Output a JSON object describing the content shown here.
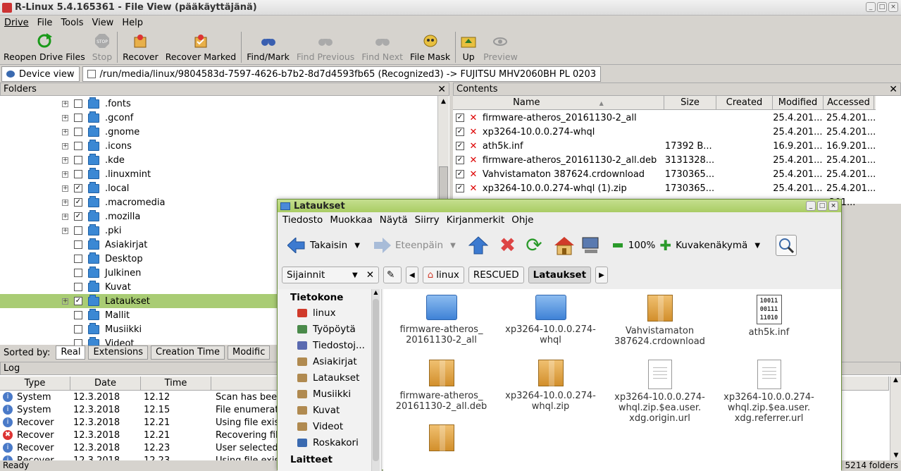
{
  "window": {
    "title": "R-Linux 5.4.165361 - File View (pääkäyttäjänä)"
  },
  "menu": [
    "Drive",
    "File",
    "Tools",
    "View",
    "Help"
  ],
  "toolbar": {
    "buttons": [
      {
        "label": "Reopen Drive Files",
        "icon": "reload-icon",
        "enabled": true
      },
      {
        "label": "Stop",
        "icon": "stop-icon",
        "enabled": false
      },
      {
        "label": "Recover",
        "icon": "recover-icon",
        "enabled": true
      },
      {
        "label": "Recover Marked",
        "icon": "recover-marked-icon",
        "enabled": true
      },
      {
        "label": "Find/Mark",
        "icon": "binoculars-icon",
        "enabled": true
      },
      {
        "label": "Find Previous",
        "icon": "binoculars-icon",
        "enabled": false
      },
      {
        "label": "Find Next",
        "icon": "binoculars-icon",
        "enabled": false
      },
      {
        "label": "File Mask",
        "icon": "mask-icon",
        "enabled": true
      },
      {
        "label": "Up",
        "icon": "up-folder-icon",
        "enabled": true
      },
      {
        "label": "Preview",
        "icon": "eye-icon",
        "enabled": false
      }
    ]
  },
  "tabs": {
    "device_view": "Device view",
    "path": "/run/media/linux/9804583d-7597-4626-b7b2-8d7d4593fb65 (Recognized3) -> FUJITSU MHV2060BH PL 0203"
  },
  "folders": {
    "header": "Folders",
    "items": [
      {
        "name": ".fonts",
        "checked": false,
        "expander": true
      },
      {
        "name": ".gconf",
        "checked": false,
        "expander": true
      },
      {
        "name": ".gnome",
        "checked": false,
        "expander": true
      },
      {
        "name": ".icons",
        "checked": false,
        "expander": true
      },
      {
        "name": ".kde",
        "checked": false,
        "expander": true
      },
      {
        "name": ".linuxmint",
        "checked": false,
        "expander": true
      },
      {
        "name": ".local",
        "checked": true,
        "expander": true
      },
      {
        "name": ".macromedia",
        "checked": true,
        "expander": true
      },
      {
        "name": ".mozilla",
        "checked": true,
        "expander": true
      },
      {
        "name": ".pki",
        "checked": false,
        "expander": true
      },
      {
        "name": "Asiakirjat",
        "checked": false,
        "expander": false
      },
      {
        "name": "Desktop",
        "checked": false,
        "expander": false
      },
      {
        "name": "Julkinen",
        "checked": false,
        "expander": false
      },
      {
        "name": "Kuvat",
        "checked": false,
        "expander": false
      },
      {
        "name": "Lataukset",
        "checked": true,
        "expander": true,
        "selected": true
      },
      {
        "name": "Mallit",
        "checked": false,
        "expander": false
      },
      {
        "name": "Musiikki",
        "checked": false,
        "expander": false
      },
      {
        "name": "Videot",
        "checked": false,
        "expander": false
      }
    ]
  },
  "contents": {
    "header": "Contents",
    "columns": [
      "Name",
      "Size",
      "Created",
      "Modified",
      "Accessed"
    ],
    "rows": [
      {
        "name": "firmware-atheros_20161130-2_all",
        "size": "",
        "created": "",
        "modified": "25.4.201...",
        "accessed": "25.4.201..."
      },
      {
        "name": "xp3264-10.0.0.274-whql",
        "size": "",
        "created": "",
        "modified": "25.4.201...",
        "accessed": "25.4.201..."
      },
      {
        "name": "ath5k.inf",
        "size": "17392 B...",
        "created": "",
        "modified": "16.9.201...",
        "accessed": "16.9.201..."
      },
      {
        "name": "firmware-atheros_20161130-2_all.deb",
        "size": "3131328...",
        "created": "",
        "modified": "25.4.201...",
        "accessed": "25.4.201..."
      },
      {
        "name": "Vahvistamaton 387624.crdownload",
        "size": "1730365...",
        "created": "",
        "modified": "25.4.201...",
        "accessed": "25.4.201..."
      },
      {
        "name": "xp3264-10.0.0.274-whql (1).zip",
        "size": "1730365...",
        "created": "",
        "modified": "25.4.201...",
        "accessed": "25.4.201..."
      },
      {
        "name": "",
        "size": "",
        "created": "",
        "modified": "",
        "accessed": ".201..."
      }
    ]
  },
  "sortbar": {
    "label": "Sorted by:",
    "tabs": [
      "Real",
      "Extensions",
      "Creation Time",
      "Modific"
    ]
  },
  "log": {
    "header": "Log",
    "columns": [
      "Type",
      "Date",
      "Time"
    ],
    "rows": [
      {
        "type": "System",
        "date": "12.3.2018",
        "time": "12.12",
        "text": "Scan has bee",
        "error": false
      },
      {
        "type": "System",
        "date": "12.3.2018",
        "time": "12.15",
        "text": "File enumerati",
        "error": false
      },
      {
        "type": "Recover",
        "date": "12.3.2018",
        "time": "12.21",
        "text": "Using file exis",
        "error": false
      },
      {
        "type": "Recover",
        "date": "12.3.2018",
        "time": "12.21",
        "text": "Recovering file",
        "error": true
      },
      {
        "type": "Recover",
        "date": "12.3.2018",
        "time": "12.23",
        "text": "User selected",
        "error": false
      },
      {
        "type": "Recover",
        "date": "12.3.2018",
        "time": "12.23",
        "text": "Using file exis",
        "error": false
      }
    ]
  },
  "status": {
    "left": "Ready",
    "right": "5214 folders"
  },
  "nautilus": {
    "title": "Lataukset",
    "menu": [
      "Tiedosto",
      "Muokkaa",
      "Näytä",
      "Siirry",
      "Kirjanmerkit",
      "Ohje"
    ],
    "back": "Takaisin",
    "forward": "Eteenpäin",
    "zoom": "100%",
    "view": "Kuvakenäkymä",
    "places_label": "Sijainnit",
    "crumbs": [
      "linux",
      "RESCUED",
      "Lataukset"
    ],
    "sidebar_heading": "Tietokone",
    "sidebar": [
      "linux",
      "Työpöytä",
      "Tiedostoj...",
      "Asiakirjat",
      "Lataukset",
      "Musiikki",
      "Kuvat",
      "Videot",
      "Roskakori"
    ],
    "sidebar_heading2": "Laitteet",
    "files": [
      {
        "name": "firmware-atheros_\n20161130-2_all",
        "kind": "folder"
      },
      {
        "name": "xp3264-10.0.0.274-\nwhql",
        "kind": "folder"
      },
      {
        "name": "Vahvistamaton\n387624.crdownload",
        "kind": "archive"
      },
      {
        "name": "ath5k.inf",
        "kind": "binary"
      },
      {
        "name": "firmware-atheros_\n20161130-2_all.deb",
        "kind": "archive"
      },
      {
        "name": "xp3264-10.0.0.274-\nwhql.zip",
        "kind": "archive"
      },
      {
        "name": "xp3264-10.0.0.274-\nwhql.zip.$ea.user.\nxdg.origin.url",
        "kind": "document"
      },
      {
        "name": "xp3264-10.0.0.274-\nwhql.zip.$ea.user.\nxdg.referrer.url",
        "kind": "document"
      },
      {
        "name": "",
        "kind": "archive"
      }
    ],
    "binary_text": "10011\n00111\n11010"
  }
}
